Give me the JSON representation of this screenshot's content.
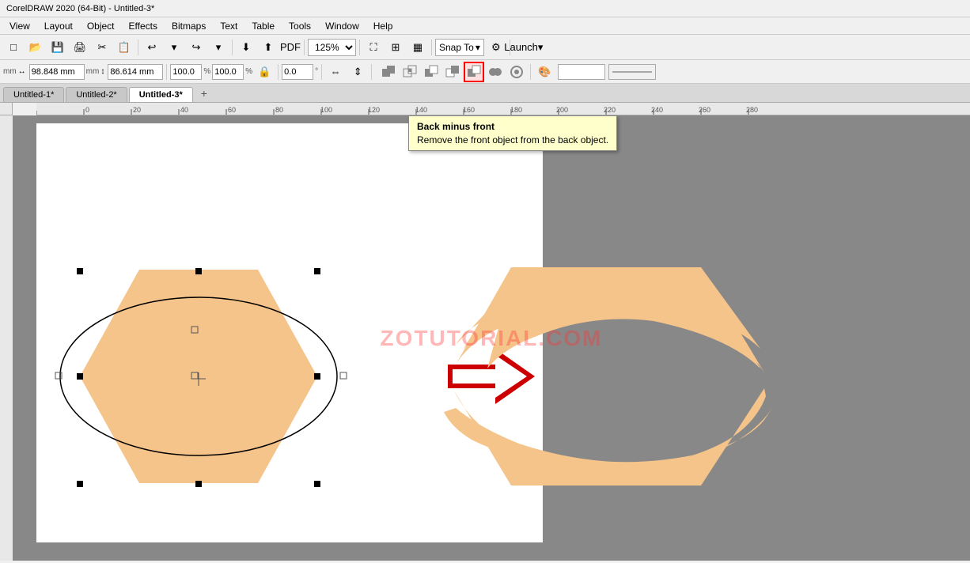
{
  "titlebar": {
    "text": "CorelDRAW 2020 (64-Bit) - Untitled-3*"
  },
  "menubar": {
    "items": [
      "View",
      "Layout",
      "Object",
      "Effects",
      "Bitmaps",
      "Text",
      "Table",
      "Tools",
      "Window",
      "Help"
    ]
  },
  "toolbar1": {
    "zoom_value": "125%",
    "snap_label": "Snap To",
    "launch_label": "Launch"
  },
  "toolbar2": {
    "width_label": "mm",
    "height_label": "mm",
    "width_value": "98.848 mm",
    "height_value": "86.614 mm",
    "scale_w": "100.0",
    "scale_h": "100.0",
    "angle_value": "0.0",
    "shapeops": [
      {
        "id": "weld",
        "label": "⊞",
        "title": "Weld"
      },
      {
        "id": "intersect",
        "label": "⊟",
        "title": "Intersect"
      },
      {
        "id": "trim",
        "label": "⊠",
        "title": "Trim"
      },
      {
        "id": "front-minus-back",
        "label": "▣",
        "title": "Front minus back"
      },
      {
        "id": "back-minus-front",
        "label": "▣",
        "title": "Back minus front",
        "active": true
      },
      {
        "id": "simplify",
        "label": "⊕",
        "title": "Simplify"
      },
      {
        "id": "boundary",
        "label": "◉",
        "title": "Boundary"
      }
    ]
  },
  "tabs": {
    "items": [
      {
        "label": "Untitled-1*",
        "active": false
      },
      {
        "label": "Untitled-2*",
        "active": false
      },
      {
        "label": "Untitled-3*",
        "active": true
      }
    ],
    "add_label": "+"
  },
  "tooltip": {
    "title": "Back minus front",
    "description": "Remove the front object from the back object."
  },
  "watermark": {
    "text": "ZOTUTORIAL.COM"
  },
  "ruler": {
    "marks": [
      "0",
      "20",
      "40",
      "60",
      "80",
      "100",
      "120",
      "140",
      "160",
      "180",
      "200",
      "220",
      "240",
      "260",
      "280"
    ]
  },
  "canvas": {
    "hexagon_color": "#f5c48a",
    "result_color": "#f5c48a",
    "arrow_color": "#cc0000"
  }
}
